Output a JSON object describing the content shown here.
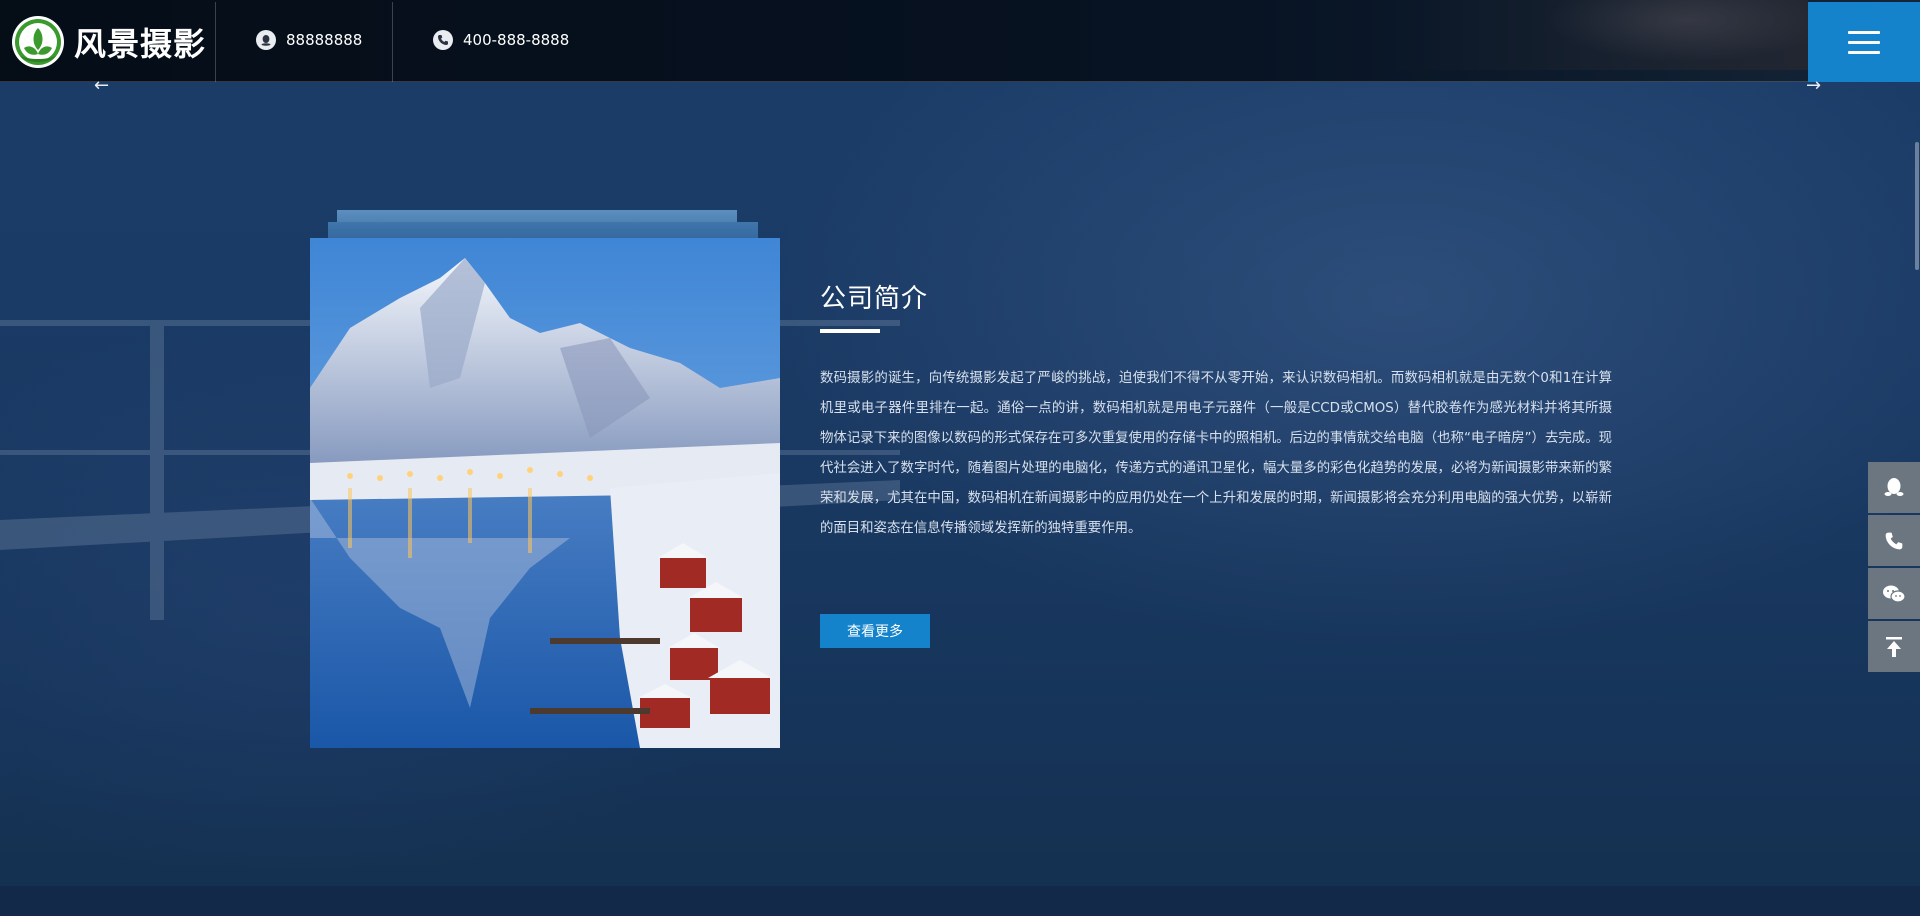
{
  "header": {
    "logo_text": "风景摄影",
    "qq_number": "88888888",
    "phone": "400-888-8888"
  },
  "carousel": {
    "prev_arrow": "←",
    "next_arrow": "→"
  },
  "about": {
    "title": "公司简介",
    "body": "数码摄影的诞生，向传统摄影发起了严峻的挑战，迫使我们不得不从零开始，来认识数码相机。而数码相机就是由无数个0和1在计算机里或电子器件里排在一起。通俗一点的讲，数码相机就是用电子元器件（一般是CCD或CMOS）替代胶卷作为感光材料并将其所摄物体记录下来的图像以数码的形式保存在可多次重复使用的存储卡中的照相机。后边的事情就交给电脑（也称“电子暗房”）去完成。现代社会进入了数字时代，随着图片处理的电脑化，传递方式的通讯卫星化，幅大量多的彩色化趋势的发展，必将为新闻摄影带来新的繁荣和发展，尤其在中国，数码相机在新闻摄影中的应用仍处在一个上升和发展的时期，新闻摄影将会充分利用电脑的强大优势，以崭新的面目和姿态在信息传播领域发挥新的独特重要作用。",
    "more_label": "查看更多"
  },
  "side_tools": [
    "qq-icon",
    "phone-icon",
    "wechat-icon",
    "back-to-top-icon"
  ],
  "colors": {
    "accent": "#1483cc",
    "background": "#1a3a64",
    "side_tool": "#6b7681"
  }
}
